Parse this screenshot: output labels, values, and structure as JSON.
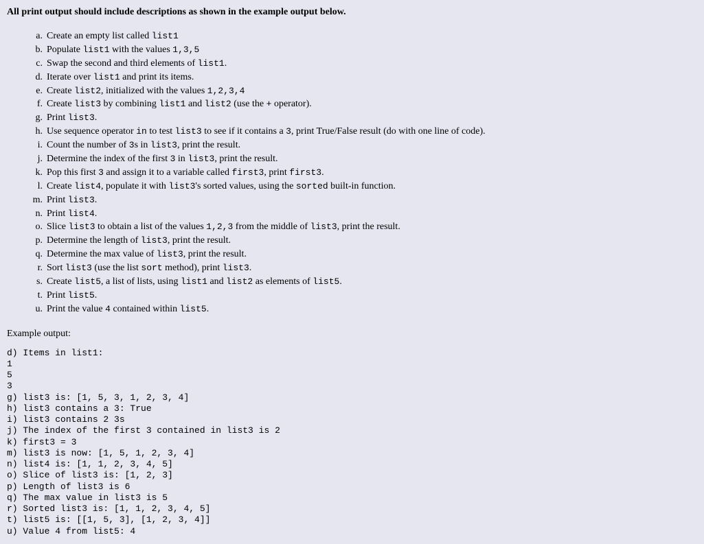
{
  "heading": "All print output should include descriptions as shown in the example output below.",
  "instructions": [
    {
      "marker": "a.",
      "segments": [
        {
          "t": "Create an empty list called "
        },
        {
          "t": "list1",
          "mono": true
        }
      ]
    },
    {
      "marker": "b.",
      "segments": [
        {
          "t": "Populate "
        },
        {
          "t": "list1",
          "mono": true
        },
        {
          "t": " with the values "
        },
        {
          "t": "1,3,5",
          "mono": true
        }
      ]
    },
    {
      "marker": "c.",
      "segments": [
        {
          "t": "Swap the second and third elements of "
        },
        {
          "t": "list1",
          "mono": true
        },
        {
          "t": "."
        }
      ]
    },
    {
      "marker": "d.",
      "segments": [
        {
          "t": "Iterate over "
        },
        {
          "t": "list1",
          "mono": true
        },
        {
          "t": " and print its items."
        }
      ]
    },
    {
      "marker": "e.",
      "segments": [
        {
          "t": "Create "
        },
        {
          "t": "list2",
          "mono": true
        },
        {
          "t": ", initialized with the values "
        },
        {
          "t": "1,2,3,4",
          "mono": true
        }
      ]
    },
    {
      "marker": "f.",
      "segments": [
        {
          "t": "Create "
        },
        {
          "t": "list3",
          "mono": true
        },
        {
          "t": " by combining "
        },
        {
          "t": "list1",
          "mono": true
        },
        {
          "t": " and "
        },
        {
          "t": "list2",
          "mono": true
        },
        {
          "t": " (use the "
        },
        {
          "t": "+",
          "mono": true
        },
        {
          "t": " operator)."
        }
      ]
    },
    {
      "marker": "g.",
      "segments": [
        {
          "t": "Print "
        },
        {
          "t": "list3",
          "mono": true
        },
        {
          "t": "."
        }
      ]
    },
    {
      "marker": "h.",
      "segments": [
        {
          "t": "Use sequence operator "
        },
        {
          "t": "in",
          "mono": true
        },
        {
          "t": " to test "
        },
        {
          "t": "list3",
          "mono": true
        },
        {
          "t": " to see if it contains a "
        },
        {
          "t": "3",
          "mono": true
        },
        {
          "t": ", print True/False result (do with one line of code)."
        }
      ]
    },
    {
      "marker": "i.",
      "segments": [
        {
          "t": "Count the number of "
        },
        {
          "t": "3",
          "mono": true
        },
        {
          "t": "s in "
        },
        {
          "t": "list3",
          "mono": true
        },
        {
          "t": ", print the result."
        }
      ]
    },
    {
      "marker": "j.",
      "segments": [
        {
          "t": "Determine the index of the first "
        },
        {
          "t": "3",
          "mono": true
        },
        {
          "t": " in "
        },
        {
          "t": "list3",
          "mono": true
        },
        {
          "t": ", print the result."
        }
      ]
    },
    {
      "marker": "k.",
      "segments": [
        {
          "t": "Pop this first "
        },
        {
          "t": "3",
          "mono": true
        },
        {
          "t": " and assign it to a variable called "
        },
        {
          "t": "first3",
          "mono": true
        },
        {
          "t": ", print "
        },
        {
          "t": "first3",
          "mono": true
        },
        {
          "t": "."
        }
      ]
    },
    {
      "marker": "l.",
      "segments": [
        {
          "t": "Create "
        },
        {
          "t": "list4",
          "mono": true
        },
        {
          "t": ", populate it with "
        },
        {
          "t": "list3",
          "mono": true
        },
        {
          "t": "'s sorted values, using the "
        },
        {
          "t": "sorted",
          "mono": true
        },
        {
          "t": " built-in function."
        }
      ]
    },
    {
      "marker": "m.",
      "segments": [
        {
          "t": "Print "
        },
        {
          "t": "list3",
          "mono": true
        },
        {
          "t": "."
        }
      ]
    },
    {
      "marker": "n.",
      "segments": [
        {
          "t": "Print "
        },
        {
          "t": "list4",
          "mono": true
        },
        {
          "t": "."
        }
      ]
    },
    {
      "marker": "o.",
      "segments": [
        {
          "t": "Slice "
        },
        {
          "t": "list3",
          "mono": true
        },
        {
          "t": " to obtain a list of the values "
        },
        {
          "t": "1,2,3",
          "mono": true
        },
        {
          "t": " from the middle of "
        },
        {
          "t": "list3",
          "mono": true
        },
        {
          "t": ", print the result."
        }
      ]
    },
    {
      "marker": "p.",
      "segments": [
        {
          "t": "Determine the length of "
        },
        {
          "t": "list3",
          "mono": true
        },
        {
          "t": ", print the result."
        }
      ]
    },
    {
      "marker": "q.",
      "segments": [
        {
          "t": "Determine the max value of "
        },
        {
          "t": "list3",
          "mono": true
        },
        {
          "t": ", print the result."
        }
      ]
    },
    {
      "marker": "r.",
      "segments": [
        {
          "t": "Sort "
        },
        {
          "t": "list3",
          "mono": true
        },
        {
          "t": " (use the list "
        },
        {
          "t": "sort",
          "mono": true
        },
        {
          "t": " method), print "
        },
        {
          "t": "list3",
          "mono": true
        },
        {
          "t": "."
        }
      ]
    },
    {
      "marker": "s.",
      "segments": [
        {
          "t": "Create "
        },
        {
          "t": "list5",
          "mono": true
        },
        {
          "t": ", a list of lists, using "
        },
        {
          "t": "list1",
          "mono": true
        },
        {
          "t": " and "
        },
        {
          "t": "list2",
          "mono": true
        },
        {
          "t": " as elements of "
        },
        {
          "t": "list5",
          "mono": true
        },
        {
          "t": "."
        }
      ]
    },
    {
      "marker": "t.",
      "segments": [
        {
          "t": "Print "
        },
        {
          "t": "list5",
          "mono": true
        },
        {
          "t": "."
        }
      ]
    },
    {
      "marker": "u.",
      "segments": [
        {
          "t": "Print the value "
        },
        {
          "t": "4",
          "mono": true
        },
        {
          "t": " contained within "
        },
        {
          "t": "list5",
          "mono": true
        },
        {
          "t": "."
        }
      ]
    }
  ],
  "example_label": "Example output:",
  "output_lines": [
    "d) Items in list1:",
    "1",
    "5",
    "3",
    "g) list3 is: [1, 5, 3, 1, 2, 3, 4]",
    "h) list3 contains a 3: True",
    "i) list3 contains 2 3s",
    "j) The index of the first 3 contained in list3 is 2",
    "k) first3 = 3",
    "m) list3 is now: [1, 5, 1, 2, 3, 4]",
    "n) list4 is: [1, 1, 2, 3, 4, 5]",
    "o) Slice of list3 is: [1, 2, 3]",
    "p) Length of list3 is 6",
    "q) The max value in list3 is 5",
    "r) Sorted list3 is: [1, 1, 2, 3, 4, 5]",
    "t) list5 is: [[1, 5, 3], [1, 2, 3, 4]]",
    "u) Value 4 from list5: 4"
  ]
}
